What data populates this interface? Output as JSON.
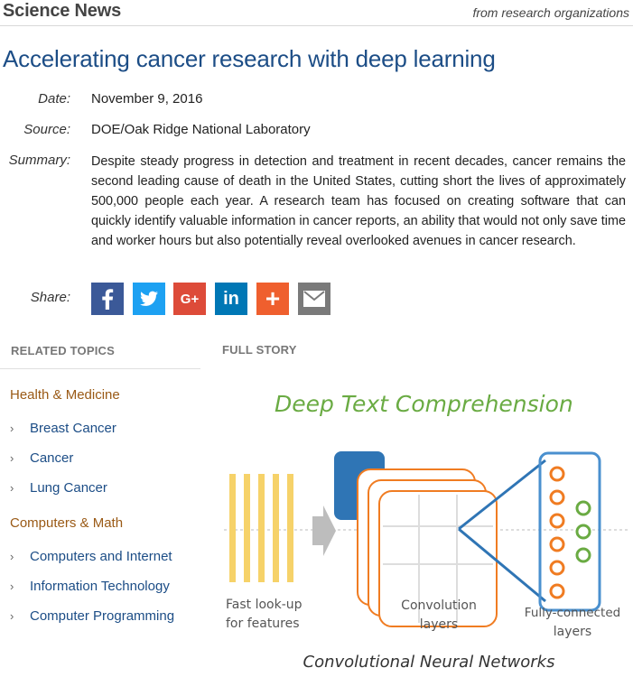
{
  "header": {
    "brand": "Science News",
    "tagline": "from research organizations"
  },
  "article": {
    "title": "Accelerating cancer research with deep learning",
    "date_label": "Date:",
    "date": "November 9, 2016",
    "source_label": "Source:",
    "source": "DOE/Oak Ridge National Laboratory",
    "summary_label": "Summary:",
    "summary": "Despite steady progress in detection and treatment in recent decades, cancer remains the second leading cause of death in the United States, cutting short the lives of approximately 500,000 people each year. A research team has focused on creating software that can quickly identify valuable information in cancer reports, an ability that would not only save time and worker hours but also potentially reveal overlooked avenues in cancer research.",
    "share_label": "Share:"
  },
  "share_buttons": [
    {
      "name": "facebook",
      "icon": "facebook-icon",
      "color": "#3b5998"
    },
    {
      "name": "twitter",
      "icon": "twitter-icon",
      "color": "#1da1f2"
    },
    {
      "name": "google-plus",
      "icon": "google-plus-icon",
      "color": "#dd4b39",
      "label": "G+"
    },
    {
      "name": "linkedin",
      "icon": "linkedin-icon",
      "color": "#0077b5",
      "label": "in"
    },
    {
      "name": "more",
      "icon": "plus-icon",
      "color": "#ef5f2e",
      "label": "+"
    },
    {
      "name": "email",
      "icon": "envelope-icon",
      "color": "#7a7a7a"
    }
  ],
  "sidebar": {
    "heading": "RELATED TOPICS",
    "categories": [
      {
        "label": "Health & Medicine",
        "items": [
          "Breast Cancer",
          "Cancer",
          "Lung Cancer"
        ]
      },
      {
        "label": "Computers & Math",
        "items": [
          "Computers and Internet",
          "Information Technology",
          "Computer Programming"
        ]
      }
    ]
  },
  "story": {
    "heading": "FULL STORY",
    "figure": {
      "title": "Deep Text Comprehension",
      "label_features_1": "Fast look-up",
      "label_features_2": "for features",
      "label_conv_1": "Convolution",
      "label_conv_2": "layers",
      "label_fc_1": "Fully-connected",
      "label_fc_2": "layers",
      "caption": "Convolutional Neural Networks"
    }
  },
  "colors": {
    "title_blue": "#1c4d86",
    "category_brown": "#9a5a16",
    "figure_green": "#6aab43",
    "figure_orange": "#f07c22",
    "figure_blue": "#2f75b5",
    "feature_yellow": "#f6d269"
  }
}
